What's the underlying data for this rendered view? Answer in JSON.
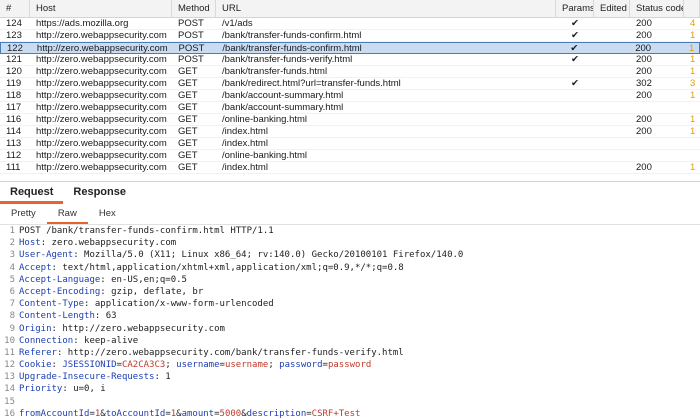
{
  "table": {
    "columns": [
      "#",
      "Host",
      "Method",
      "URL",
      "Params",
      "Edited",
      "Status code",
      ""
    ],
    "rows": [
      {
        "num": "124",
        "host": "https://ads.mozilla.org",
        "method": "POST",
        "url": "/v1/ads",
        "params": "✔",
        "edited": "",
        "status": "200",
        "mark": "4"
      },
      {
        "num": "123",
        "host": "http://zero.webappsecurity.com",
        "method": "POST",
        "url": "/bank/transfer-funds-confirm.html",
        "params": "✔",
        "edited": "",
        "status": "200",
        "mark": "1"
      },
      {
        "num": "122",
        "host": "http://zero.webappsecurity.com",
        "method": "POST",
        "url": "/bank/transfer-funds-confirm.html",
        "params": "✔",
        "edited": "",
        "status": "200",
        "mark": "1",
        "selected": true
      },
      {
        "num": "121",
        "host": "http://zero.webappsecurity.com",
        "method": "POST",
        "url": "/bank/transfer-funds-verify.html",
        "params": "✔",
        "edited": "",
        "status": "200",
        "mark": "1"
      },
      {
        "num": "120",
        "host": "http://zero.webappsecurity.com",
        "method": "GET",
        "url": "/bank/transfer-funds.html",
        "params": "",
        "edited": "",
        "status": "200",
        "mark": "1"
      },
      {
        "num": "119",
        "host": "http://zero.webappsecurity.com",
        "method": "GET",
        "url": "/bank/redirect.html?url=transfer-funds.html",
        "params": "✔",
        "edited": "",
        "status": "302",
        "mark": "3"
      },
      {
        "num": "118",
        "host": "http://zero.webappsecurity.com",
        "method": "GET",
        "url": "/bank/account-summary.html",
        "params": "",
        "edited": "",
        "status": "200",
        "mark": "1"
      },
      {
        "num": "117",
        "host": "http://zero.webappsecurity.com",
        "method": "GET",
        "url": "/bank/account-summary.html",
        "params": "",
        "edited": "",
        "status": "",
        "mark": ""
      },
      {
        "num": "116",
        "host": "http://zero.webappsecurity.com",
        "method": "GET",
        "url": "/online-banking.html",
        "params": "",
        "edited": "",
        "status": "200",
        "mark": "1"
      },
      {
        "num": "114",
        "host": "http://zero.webappsecurity.com",
        "method": "GET",
        "url": "/index.html",
        "params": "",
        "edited": "",
        "status": "200",
        "mark": "1"
      },
      {
        "num": "113",
        "host": "http://zero.webappsecurity.com",
        "method": "GET",
        "url": "/index.html",
        "params": "",
        "edited": "",
        "status": "",
        "mark": ""
      },
      {
        "num": "112",
        "host": "http://zero.webappsecurity.com",
        "method": "GET",
        "url": "/online-banking.html",
        "params": "",
        "edited": "",
        "status": "",
        "mark": ""
      },
      {
        "num": "111",
        "host": "http://zero.webappsecurity.com",
        "method": "GET",
        "url": "/index.html",
        "params": "",
        "edited": "",
        "status": "200",
        "mark": "1"
      }
    ]
  },
  "tabs": {
    "request": "Request",
    "response": "Response"
  },
  "subtabs": {
    "pretty": "Pretty",
    "raw": "Raw",
    "hex": "Hex"
  },
  "request_lines": [
    {
      "n": "1",
      "kind": "plain",
      "text": "POST /bank/transfer-funds-confirm.html HTTP/1.1"
    },
    {
      "n": "2",
      "kind": "header",
      "name": "Host",
      "value": " zero.webappsecurity.com"
    },
    {
      "n": "3",
      "kind": "header",
      "name": "User-Agent",
      "value": " Mozilla/5.0 (X11; Linux x86_64; rv:140.0) Gecko/20100101 Firefox/140.0"
    },
    {
      "n": "4",
      "kind": "header",
      "name": "Accept",
      "value": " text/html,application/xhtml+xml,application/xml;q=0.9,*/*;q=0.8"
    },
    {
      "n": "5",
      "kind": "header",
      "name": "Accept-Language",
      "value": " en-US,en;q=0.5"
    },
    {
      "n": "6",
      "kind": "header",
      "name": "Accept-Encoding",
      "value": " gzip, deflate, br"
    },
    {
      "n": "7",
      "kind": "header",
      "name": "Content-Type",
      "value": " application/x-www-form-urlencoded"
    },
    {
      "n": "8",
      "kind": "header",
      "name": "Content-Length",
      "value": " 63"
    },
    {
      "n": "9",
      "kind": "header",
      "name": "Origin",
      "value": " http://zero.webappsecurity.com"
    },
    {
      "n": "10",
      "kind": "header",
      "name": "Connection",
      "value": " keep-alive"
    },
    {
      "n": "11",
      "kind": "header",
      "name": "Referer",
      "value": " http://zero.webappsecurity.com/bank/transfer-funds-verify.html"
    },
    {
      "n": "12",
      "kind": "cookie",
      "name": "Cookie",
      "parts": [
        {
          "k": "JSESSIONID",
          "v": "CA2CA3C3"
        },
        {
          "k": "username",
          "v": "username"
        },
        {
          "k": "password",
          "v": "password"
        }
      ]
    },
    {
      "n": "13",
      "kind": "header",
      "name": "Upgrade-Insecure-Requests",
      "value": " 1"
    },
    {
      "n": "14",
      "kind": "header",
      "name": "Priority",
      "value": " u=0, i"
    },
    {
      "n": "15",
      "kind": "plain",
      "text": ""
    },
    {
      "n": "16",
      "kind": "body",
      "parts": [
        {
          "k": "fromAccountId",
          "v": "1"
        },
        {
          "k": "toAccountId",
          "v": "1"
        },
        {
          "k": "amount",
          "v": "5000"
        },
        {
          "k": "description",
          "v": "CSRF+Test"
        }
      ]
    }
  ]
}
